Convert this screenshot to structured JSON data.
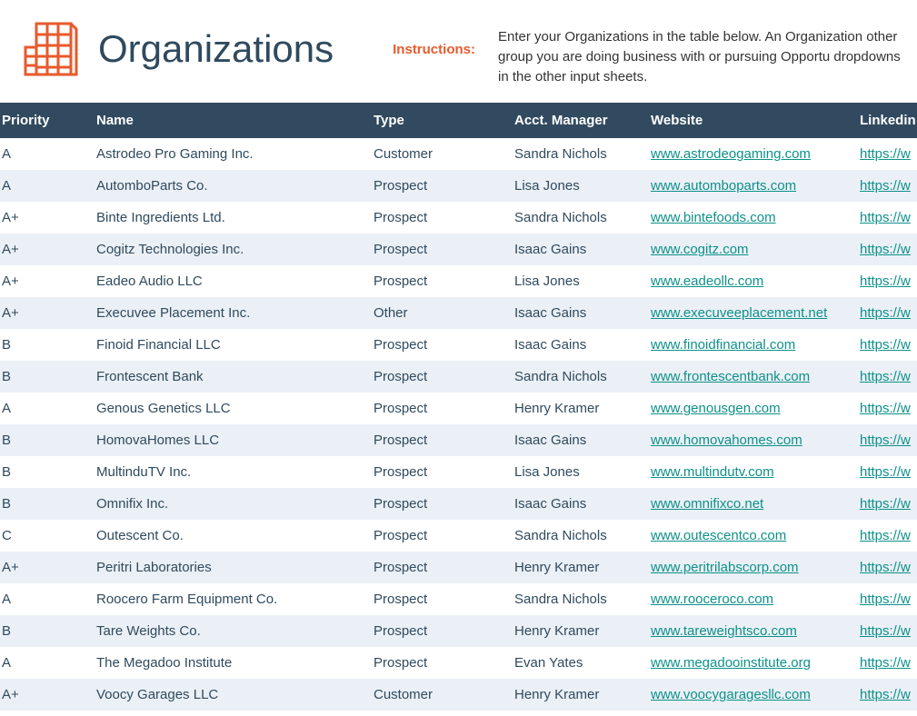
{
  "page": {
    "title": "Organizations",
    "instructions_label": "Instructions:",
    "instructions_text": "Enter your Organizations in the table below. An Organization other group you are doing business with or pursuing Opportu dropdowns in the other input sheets."
  },
  "columns": {
    "priority": "Priority",
    "name": "Name",
    "type": "Type",
    "manager": "Acct. Manager",
    "website": "Website",
    "linkedin": "Linkedin"
  },
  "rows": [
    {
      "priority": "A",
      "name": "Astrodeo Pro Gaming Inc.",
      "type": "Customer",
      "manager": "Sandra Nichols",
      "website": "www.astrodeogaming.com",
      "linkedin": "https://w"
    },
    {
      "priority": "A",
      "name": "AutomboParts Co.",
      "type": "Prospect",
      "manager": "Lisa Jones",
      "website": "www.automboparts.com",
      "linkedin": "https://w"
    },
    {
      "priority": "A+",
      "name": "Binte Ingredients Ltd.",
      "type": "Prospect",
      "manager": "Sandra Nichols",
      "website": "www.bintefoods.com",
      "linkedin": "https://w"
    },
    {
      "priority": "A+",
      "name": "Cogitz Technologies Inc.",
      "type": "Prospect",
      "manager": "Isaac Gains",
      "website": "www.cogitz.com",
      "linkedin": "https://w"
    },
    {
      "priority": "A+",
      "name": "Eadeo Audio LLC",
      "type": "Prospect",
      "manager": "Lisa Jones",
      "website": "www.eadeollc.com",
      "linkedin": "https://w"
    },
    {
      "priority": "A+",
      "name": "Execuvee Placement Inc.",
      "type": "Other",
      "manager": "Isaac Gains",
      "website": "www.execuveeplacement.net",
      "linkedin": "https://w"
    },
    {
      "priority": "B",
      "name": "Finoid Financial LLC",
      "type": "Prospect",
      "manager": "Isaac Gains",
      "website": "www.finoidfinancial.com",
      "linkedin": "https://w"
    },
    {
      "priority": "B",
      "name": "Frontescent Bank",
      "type": "Prospect",
      "manager": "Sandra Nichols",
      "website": "www.frontescentbank.com",
      "linkedin": "https://w"
    },
    {
      "priority": "A",
      "name": "Genous Genetics LLC",
      "type": "Prospect",
      "manager": "Henry Kramer",
      "website": "www.genousgen.com",
      "linkedin": "https://w"
    },
    {
      "priority": "B",
      "name": "HomovaHomes LLC",
      "type": "Prospect",
      "manager": "Isaac Gains",
      "website": "www.homovahomes.com",
      "linkedin": "https://w"
    },
    {
      "priority": "B",
      "name": "MultinduTV Inc.",
      "type": "Prospect",
      "manager": "Lisa Jones",
      "website": "www.multindutv.com",
      "linkedin": "https://w"
    },
    {
      "priority": "B",
      "name": "Omnifix Inc.",
      "type": "Prospect",
      "manager": "Isaac Gains",
      "website": "www.omnifixco.net",
      "linkedin": "https://w"
    },
    {
      "priority": "C",
      "name": "Outescent Co.",
      "type": "Prospect",
      "manager": "Sandra Nichols",
      "website": "www.outescentco.com",
      "linkedin": "https://w"
    },
    {
      "priority": "A+",
      "name": "Peritri Laboratories",
      "type": "Prospect",
      "manager": "Henry Kramer",
      "website": "www.peritrilabscorp.com",
      "linkedin": "https://w"
    },
    {
      "priority": "A",
      "name": "Roocero Farm Equipment Co.",
      "type": "Prospect",
      "manager": "Sandra Nichols",
      "website": "www.rooceroco.com",
      "linkedin": "https://w"
    },
    {
      "priority": "B",
      "name": "Tare Weights Co.",
      "type": "Prospect",
      "manager": "Henry Kramer",
      "website": "www.tareweightsco.com",
      "linkedin": "https://w"
    },
    {
      "priority": "A",
      "name": "The Megadoo Institute",
      "type": "Prospect",
      "manager": "Evan Yates",
      "website": "www.megadooinstitute.org",
      "linkedin": "https://w"
    },
    {
      "priority": "A+",
      "name": "Voocy Garages LLC",
      "type": "Customer",
      "manager": "Henry Kramer",
      "website": "www.voocygaragesllc.com",
      "linkedin": "https://w"
    }
  ]
}
